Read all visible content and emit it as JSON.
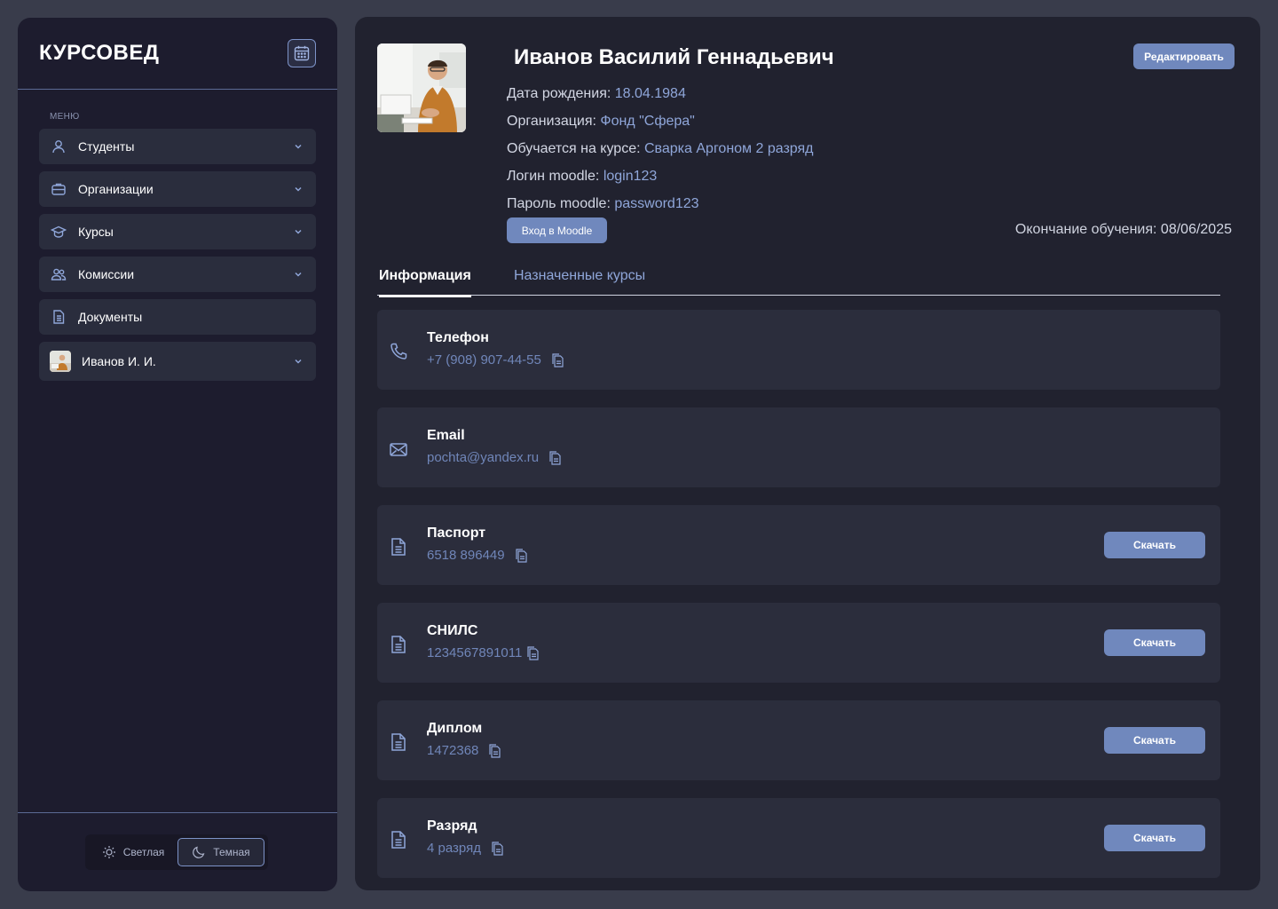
{
  "app": {
    "logo": "КУРСОВЕД"
  },
  "sidebar": {
    "menu_title": "МЕНЮ",
    "items": [
      {
        "label": "Студенты",
        "icon": "user-icon"
      },
      {
        "label": "Организации",
        "icon": "briefcase-icon"
      },
      {
        "label": "Курсы",
        "icon": "graduation-cap-icon"
      },
      {
        "label": "Комиссии",
        "icon": "users-icon"
      },
      {
        "label": "Документы",
        "icon": "document-icon"
      },
      {
        "label": "Иванов И. И.",
        "icon": "avatar"
      }
    ],
    "theme": {
      "light": "Светлая",
      "dark": "Темная",
      "selected": "dark"
    }
  },
  "profile": {
    "name": "Иванов Василий Геннадьевич",
    "birth_label": "Дата рождения:",
    "birth_value": "18.04.1984",
    "org_label": "Организация:",
    "org_value": "Фонд \"Сфера\"",
    "course_label": "Обучается на курсе:",
    "course_value": "Сварка Аргоном 2 разряд",
    "login_label": "Логин moodle:",
    "login_value": "login123",
    "password_label": "Пароль moodle:",
    "password_value": "password123",
    "edit_button": "Редактировать",
    "moodle_button": "Вход в Moodle",
    "end_label": "Окончание обучения:",
    "end_value": "08/06/2025"
  },
  "tabs": [
    {
      "label": "Информация",
      "active": true
    },
    {
      "label": "Назначенные курсы",
      "active": false
    }
  ],
  "cards": [
    {
      "title": "Телефон",
      "value": "+7 (908) 907-44-55",
      "icon": "phone-icon"
    },
    {
      "title": "Email",
      "value": "pochta@yandex.ru",
      "icon": "mail-icon"
    },
    {
      "title": "Паспорт",
      "value": "6518 896449",
      "icon": "document-icon",
      "button": "Скачать"
    },
    {
      "title": "СНИЛС",
      "value": "1234567891011",
      "icon": "document-icon",
      "button": "Скачать"
    },
    {
      "title": "Диплом",
      "value": "1472368",
      "icon": "document-icon",
      "button": "Скачать"
    },
    {
      "title": "Разряд",
      "value": "4 разряд",
      "icon": "document-icon",
      "button": "Скачать"
    }
  ],
  "colors": {
    "accent": "#7088bd",
    "link": "#8fa6d9",
    "background": "#393c4b",
    "panel": "#21222f",
    "sidebar": "#1d1c2e"
  }
}
